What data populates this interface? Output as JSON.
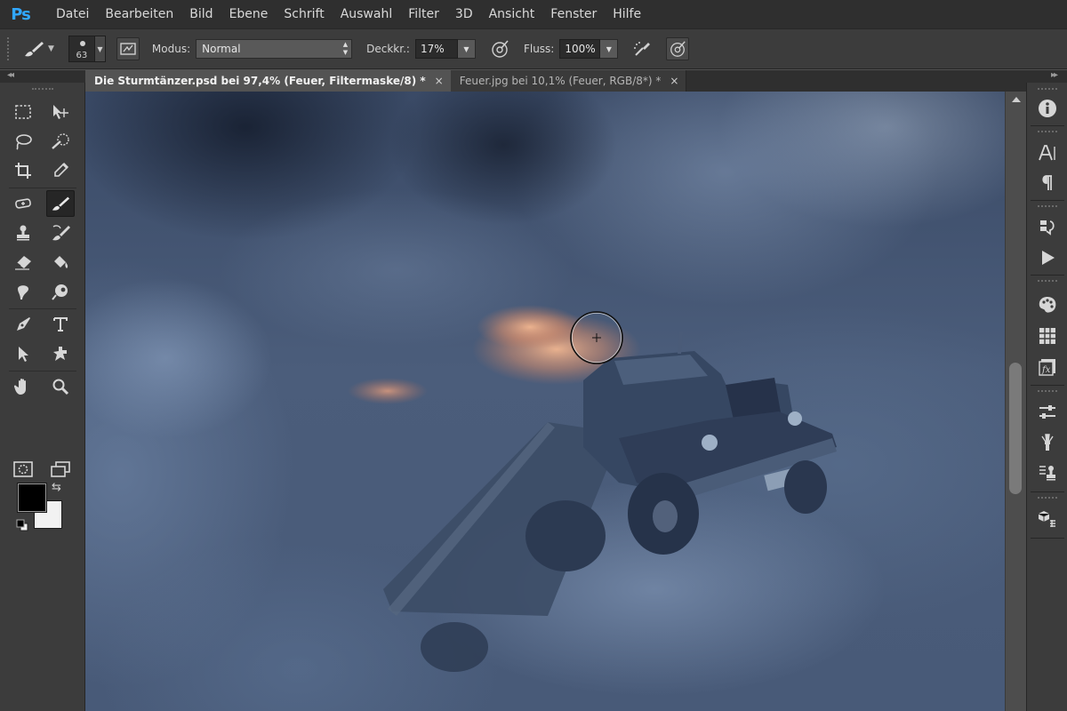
{
  "app": {
    "logo": "Ps"
  },
  "menu": [
    "Datei",
    "Bearbeiten",
    "Bild",
    "Ebene",
    "Schrift",
    "Auswahl",
    "Filter",
    "3D",
    "Ansicht",
    "Fenster",
    "Hilfe"
  ],
  "options": {
    "brush_size": "63",
    "mode_label": "Modus:",
    "mode_value": "Normal",
    "opacity_label": "Deckkr.:",
    "opacity_value": "17%",
    "flow_label": "Fluss:",
    "flow_value": "100%"
  },
  "tabs": [
    {
      "title": "Die Sturmtänzer.psd bei 97,4% (Feuer, Filtermaske/8) *",
      "close": "×"
    },
    {
      "title": "Feuer.jpg bei 10,1% (Feuer, RGB/8*) *",
      "close": "×"
    }
  ],
  "colors": {
    "foreground": "#000000",
    "background": "#f2f2f2",
    "accent": "#31a8ff"
  },
  "dock_icons": [
    "info-icon",
    "character-icon",
    "paragraph-icon",
    "history-icon",
    "actions-icon",
    "color-icon",
    "swatches-icon",
    "styles-icon",
    "adjustments-icon",
    "brush-presets-icon",
    "clone-source-icon",
    "3d-icon"
  ]
}
